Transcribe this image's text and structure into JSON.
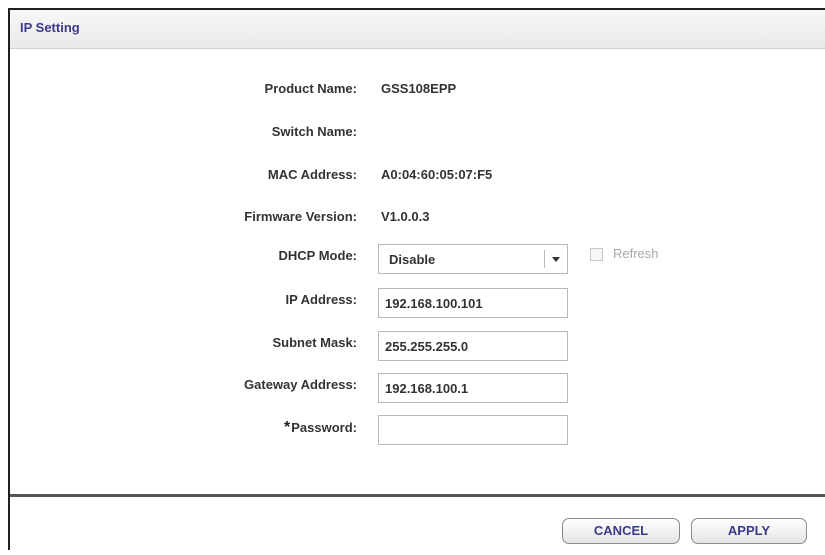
{
  "header": {
    "title": "IP Setting"
  },
  "info": {
    "product_name_label": "Product Name:",
    "product_name_value": "GSS108EPP",
    "switch_name_label": "Switch Name:",
    "switch_name_value": "",
    "mac_address_label": "MAC Address:",
    "mac_address_value": "A0:04:60:05:07:F5",
    "firmware_label": "Firmware Version:",
    "firmware_value": "V1.0.0.3"
  },
  "form": {
    "dhcp_label": "DHCP Mode:",
    "dhcp_value": "Disable",
    "refresh_label": "Refresh",
    "refresh_checked": false,
    "ip_label": "IP Address:",
    "ip_value": "192.168.100.101",
    "subnet_label": "Subnet Mask:",
    "subnet_value": "255.255.255.0",
    "gateway_label": "Gateway Address:",
    "gateway_value": "192.168.100.1",
    "password_star": "*",
    "password_label": "Password:",
    "password_value": ""
  },
  "footer": {
    "cancel_label": "CANCEL",
    "apply_label": "APPLY"
  },
  "colors": {
    "title": "#3a3a8a",
    "button_text": "#3a3a8a",
    "label_text": "#333333",
    "disabled_text": "#a8a8a8"
  },
  "icons": {
    "dropdown": "chevron-down-icon",
    "refresh_checkbox": "checkbox-icon"
  }
}
